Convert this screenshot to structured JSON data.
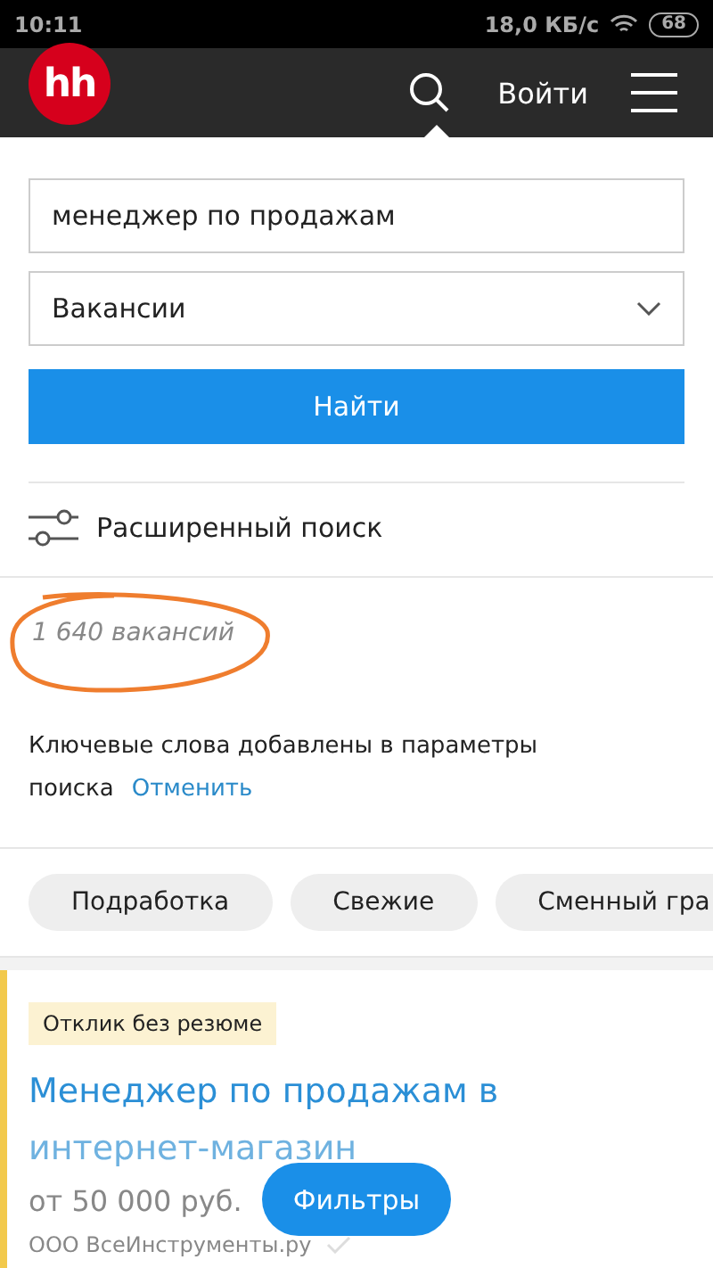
{
  "status_bar": {
    "time": "10:11",
    "speed": "18,0 КБ/с",
    "battery": "68"
  },
  "header": {
    "logo": "hh",
    "login": "Войти"
  },
  "search": {
    "query": "менеджер по продажам",
    "type": "Вакансии",
    "submit": "Найти",
    "advanced": "Расширенный поиск"
  },
  "results": {
    "count": "1 640 вакансий",
    "count_circled": true,
    "notice": "Ключевые слова добавлены в параметры поиска",
    "undo": "Отменить"
  },
  "chips": [
    {
      "label": "Подработка"
    },
    {
      "label": "Свежие"
    },
    {
      "label": "Сменный гра"
    }
  ],
  "vacancy": {
    "badge": "Отклик без резюме",
    "title_line_1": "Менеджер по продажам в",
    "title_line_2": "интернет-магазин",
    "salary": "от 50 000 руб.",
    "company": "ООО ВсеИнструменты.ру"
  },
  "filters_button": "Фильтры"
}
